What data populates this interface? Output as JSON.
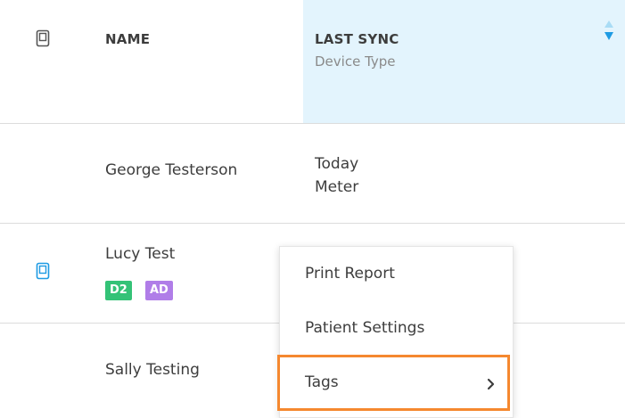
{
  "header": {
    "name_label": "NAME",
    "last_sync_label": "LAST SYNC",
    "device_type_label": "Device Type",
    "device_icon": "device-icon",
    "sort_icon": "sort-arrows-icon",
    "highlight_color": "#e3f4fd"
  },
  "rows": [
    {
      "name": "George Testerson",
      "last_sync": "Today",
      "device_type": "Meter",
      "tags": []
    },
    {
      "name": "Lucy Test",
      "last_sync": "",
      "device_type": "",
      "tags": [
        {
          "label": "D2",
          "color": "#34c277"
        },
        {
          "label": "AD",
          "color": "#b07de8"
        }
      ]
    },
    {
      "name": "Sally Testing",
      "last_sync": "",
      "device_type": "",
      "tags": []
    }
  ],
  "context_menu": {
    "items": [
      {
        "label": "Print Report"
      },
      {
        "label": "Patient Settings"
      },
      {
        "label": "Tags",
        "has_submenu": true
      }
    ],
    "highlight_color": "#f5882f"
  }
}
